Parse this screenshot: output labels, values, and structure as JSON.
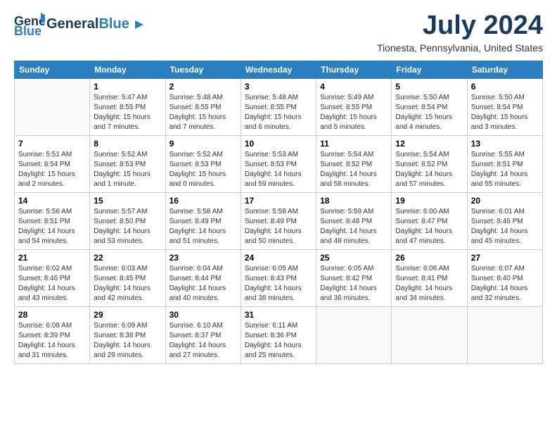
{
  "header": {
    "logo_general": "General",
    "logo_blue": "Blue",
    "month_title": "July 2024",
    "location": "Tionesta, Pennsylvania, United States"
  },
  "weekdays": [
    "Sunday",
    "Monday",
    "Tuesday",
    "Wednesday",
    "Thursday",
    "Friday",
    "Saturday"
  ],
  "weeks": [
    [
      {
        "day": "",
        "sunrise": "",
        "sunset": "",
        "daylight": ""
      },
      {
        "day": "1",
        "sunrise": "Sunrise: 5:47 AM",
        "sunset": "Sunset: 8:55 PM",
        "daylight": "Daylight: 15 hours and 7 minutes."
      },
      {
        "day": "2",
        "sunrise": "Sunrise: 5:48 AM",
        "sunset": "Sunset: 8:55 PM",
        "daylight": "Daylight: 15 hours and 7 minutes."
      },
      {
        "day": "3",
        "sunrise": "Sunrise: 5:48 AM",
        "sunset": "Sunset: 8:55 PM",
        "daylight": "Daylight: 15 hours and 6 minutes."
      },
      {
        "day": "4",
        "sunrise": "Sunrise: 5:49 AM",
        "sunset": "Sunset: 8:55 PM",
        "daylight": "Daylight: 15 hours and 5 minutes."
      },
      {
        "day": "5",
        "sunrise": "Sunrise: 5:50 AM",
        "sunset": "Sunset: 8:54 PM",
        "daylight": "Daylight: 15 hours and 4 minutes."
      },
      {
        "day": "6",
        "sunrise": "Sunrise: 5:50 AM",
        "sunset": "Sunset: 8:54 PM",
        "daylight": "Daylight: 15 hours and 3 minutes."
      }
    ],
    [
      {
        "day": "7",
        "sunrise": "Sunrise: 5:51 AM",
        "sunset": "Sunset: 8:54 PM",
        "daylight": "Daylight: 15 hours and 2 minutes."
      },
      {
        "day": "8",
        "sunrise": "Sunrise: 5:52 AM",
        "sunset": "Sunset: 8:53 PM",
        "daylight": "Daylight: 15 hours and 1 minute."
      },
      {
        "day": "9",
        "sunrise": "Sunrise: 5:52 AM",
        "sunset": "Sunset: 8:53 PM",
        "daylight": "Daylight: 15 hours and 0 minutes."
      },
      {
        "day": "10",
        "sunrise": "Sunrise: 5:53 AM",
        "sunset": "Sunset: 8:53 PM",
        "daylight": "Daylight: 14 hours and 59 minutes."
      },
      {
        "day": "11",
        "sunrise": "Sunrise: 5:54 AM",
        "sunset": "Sunset: 8:52 PM",
        "daylight": "Daylight: 14 hours and 58 minutes."
      },
      {
        "day": "12",
        "sunrise": "Sunrise: 5:54 AM",
        "sunset": "Sunset: 8:52 PM",
        "daylight": "Daylight: 14 hours and 57 minutes."
      },
      {
        "day": "13",
        "sunrise": "Sunrise: 5:55 AM",
        "sunset": "Sunset: 8:51 PM",
        "daylight": "Daylight: 14 hours and 55 minutes."
      }
    ],
    [
      {
        "day": "14",
        "sunrise": "Sunrise: 5:56 AM",
        "sunset": "Sunset: 8:51 PM",
        "daylight": "Daylight: 14 hours and 54 minutes."
      },
      {
        "day": "15",
        "sunrise": "Sunrise: 5:57 AM",
        "sunset": "Sunset: 8:50 PM",
        "daylight": "Daylight: 14 hours and 53 minutes."
      },
      {
        "day": "16",
        "sunrise": "Sunrise: 5:58 AM",
        "sunset": "Sunset: 8:49 PM",
        "daylight": "Daylight: 14 hours and 51 minutes."
      },
      {
        "day": "17",
        "sunrise": "Sunrise: 5:58 AM",
        "sunset": "Sunset: 8:49 PM",
        "daylight": "Daylight: 14 hours and 50 minutes."
      },
      {
        "day": "18",
        "sunrise": "Sunrise: 5:59 AM",
        "sunset": "Sunset: 8:48 PM",
        "daylight": "Daylight: 14 hours and 48 minutes."
      },
      {
        "day": "19",
        "sunrise": "Sunrise: 6:00 AM",
        "sunset": "Sunset: 8:47 PM",
        "daylight": "Daylight: 14 hours and 47 minutes."
      },
      {
        "day": "20",
        "sunrise": "Sunrise: 6:01 AM",
        "sunset": "Sunset: 8:46 PM",
        "daylight": "Daylight: 14 hours and 45 minutes."
      }
    ],
    [
      {
        "day": "21",
        "sunrise": "Sunrise: 6:02 AM",
        "sunset": "Sunset: 8:46 PM",
        "daylight": "Daylight: 14 hours and 43 minutes."
      },
      {
        "day": "22",
        "sunrise": "Sunrise: 6:03 AM",
        "sunset": "Sunset: 8:45 PM",
        "daylight": "Daylight: 14 hours and 42 minutes."
      },
      {
        "day": "23",
        "sunrise": "Sunrise: 6:04 AM",
        "sunset": "Sunset: 8:44 PM",
        "daylight": "Daylight: 14 hours and 40 minutes."
      },
      {
        "day": "24",
        "sunrise": "Sunrise: 6:05 AM",
        "sunset": "Sunset: 8:43 PM",
        "daylight": "Daylight: 14 hours and 38 minutes."
      },
      {
        "day": "25",
        "sunrise": "Sunrise: 6:05 AM",
        "sunset": "Sunset: 8:42 PM",
        "daylight": "Daylight: 14 hours and 36 minutes."
      },
      {
        "day": "26",
        "sunrise": "Sunrise: 6:06 AM",
        "sunset": "Sunset: 8:41 PM",
        "daylight": "Daylight: 14 hours and 34 minutes."
      },
      {
        "day": "27",
        "sunrise": "Sunrise: 6:07 AM",
        "sunset": "Sunset: 8:40 PM",
        "daylight": "Daylight: 14 hours and 32 minutes."
      }
    ],
    [
      {
        "day": "28",
        "sunrise": "Sunrise: 6:08 AM",
        "sunset": "Sunset: 8:39 PM",
        "daylight": "Daylight: 14 hours and 31 minutes."
      },
      {
        "day": "29",
        "sunrise": "Sunrise: 6:09 AM",
        "sunset": "Sunset: 8:38 PM",
        "daylight": "Daylight: 14 hours and 29 minutes."
      },
      {
        "day": "30",
        "sunrise": "Sunrise: 6:10 AM",
        "sunset": "Sunset: 8:37 PM",
        "daylight": "Daylight: 14 hours and 27 minutes."
      },
      {
        "day": "31",
        "sunrise": "Sunrise: 6:11 AM",
        "sunset": "Sunset: 8:36 PM",
        "daylight": "Daylight: 14 hours and 25 minutes."
      },
      {
        "day": "",
        "sunrise": "",
        "sunset": "",
        "daylight": ""
      },
      {
        "day": "",
        "sunrise": "",
        "sunset": "",
        "daylight": ""
      },
      {
        "day": "",
        "sunrise": "",
        "sunset": "",
        "daylight": ""
      }
    ]
  ]
}
